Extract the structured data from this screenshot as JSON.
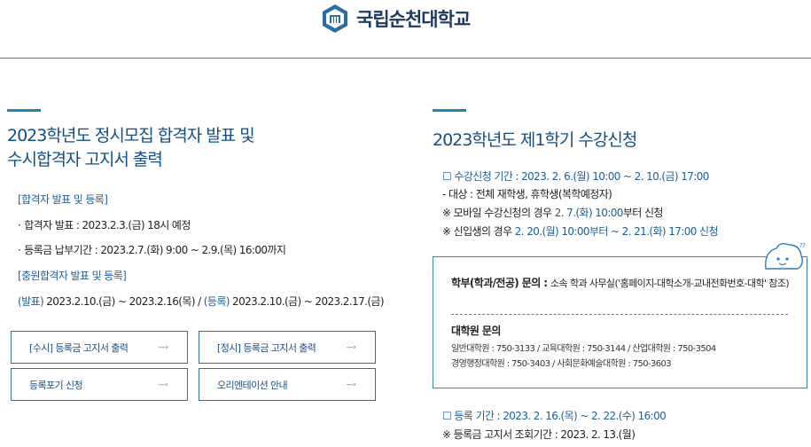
{
  "header": {
    "logo_text": "국립순천대학교"
  },
  "left": {
    "title_line1": "2023학년도 정시모집 합격자 발표 및",
    "title_line2": "수시합격자 고지서 출력",
    "section1_head": "[합격자 발표 및 등록]",
    "bullet1": "합격자 발표 : 2023.2.3.(금) 18시 예정",
    "bullet2": "등록금 납부기간 : 2023.2.7.(화) 9:00 ~ 2.9.(목) 16:00까지",
    "section2_head": "[충원합격자 발표 및 등록]",
    "dates_announce_label": "(발표)",
    "dates_announce": " 2023.2.10.(금) ~ 2023.2.16(목) / ",
    "dates_register_label": "(등록)",
    "dates_register": " 2023.2.10.(금) ~ 2023.2.17.(금)",
    "buttons": [
      {
        "label": "[수시] 등록금 고지서 출력"
      },
      {
        "label": "[정시] 등록금 고지서 출력"
      },
      {
        "label": "등록포기 신청"
      },
      {
        "label": "오리엔테이션 안내"
      }
    ],
    "arrow_glyph": "—›"
  },
  "right": {
    "title": "2023학년도 제1학기 수강신청",
    "period": "☐ 수강신청 기간 : 2023. 2. 6.(월) 10:00 ~ 2. 10.(금) 17:00",
    "target": "- 대상 : 전체 재학생, 휴학생(복학예정자)",
    "mobile_prefix": "※ 모바일 수강신청의 경우 ",
    "mobile_hl": "2. 7.(화) 10:00",
    "mobile_suffix": "부터 신청",
    "freshman_prefix": "※ 신입생의 경우 ",
    "freshman_hl": "2. 20.(월) 10:00부터 ~ 2. 21.(화) 17:00 신청",
    "box": {
      "undergrad_label": "학부(학과/전공) 문의 : ",
      "undergrad_detail": "소속 학과 사무실('홈페이지-대학소개-교내전화번호-대학' 참조)",
      "grad_head": "대학원 문의",
      "grad_line1": "일반대학원 : 750-3133 / 교육대학원 : 750-3144 / 산업대학원 : 750-3504",
      "grad_line2": "경영행정대학원 : 750-3403 / 사회문화예술대학원 : 750-3603"
    },
    "register_period": "☐ 등록 기간 : 2023. 2. 16.(목) ~ 2. 22.(수) 16:00",
    "tuition_notice": "※ 등록금 고지서 조회기간 : 2023. 2. 13.(월)"
  },
  "colors": {
    "primary": "#134f86",
    "accent": "#1e86b8",
    "link": "#1e5e99",
    "logo": "#1d3a5f"
  },
  "icons": {
    "logo": "university-emblem-icon",
    "arrow": "arrow-right-icon",
    "help": "speech-bubble-icon"
  }
}
